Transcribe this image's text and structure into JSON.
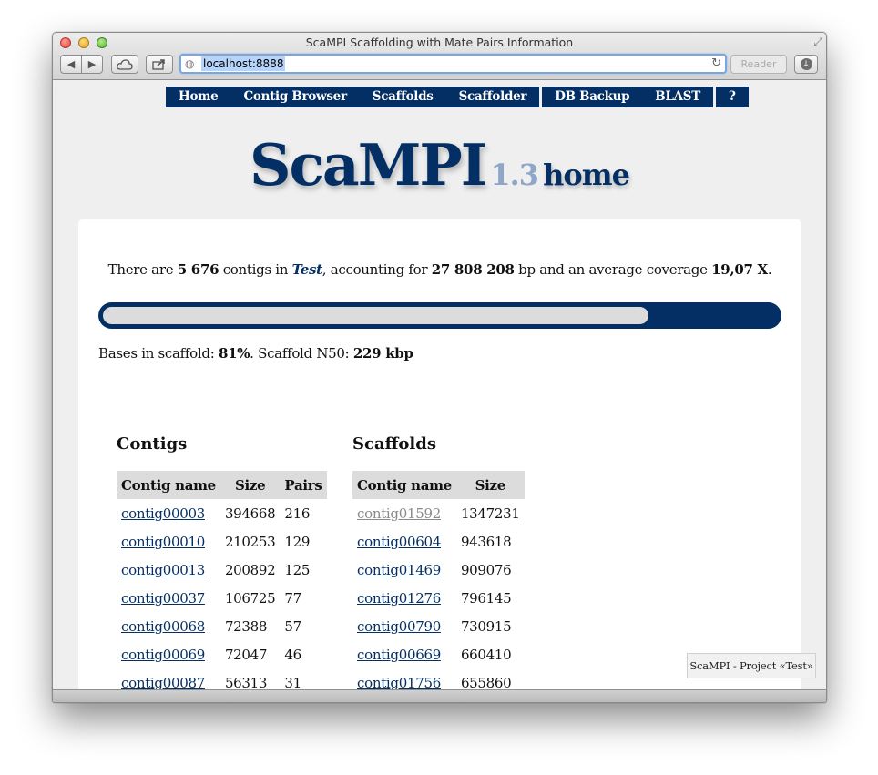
{
  "window": {
    "title": "ScaMPI Scaffolding with Mate Pairs Information",
    "url": "localhost:8888",
    "reader_label": "Reader"
  },
  "icons": {
    "back": "chevron-left-icon",
    "forward": "chevron-right-icon",
    "icloud": "cloud-icon",
    "share": "share-icon",
    "globe": "globe-icon",
    "reload": "reload-icon",
    "downloads": "download-icon",
    "fullscreen": "fullscreen-icon"
  },
  "nav": {
    "group1": [
      "Home",
      "Contig Browser",
      "Scaffolds",
      "Scaffolder"
    ],
    "group2": [
      "DB Backup",
      "BLAST"
    ],
    "group3": [
      "?"
    ]
  },
  "logo": {
    "name": "ScaMPI",
    "version": "1.3",
    "page": "home"
  },
  "summary": {
    "t1": "There are ",
    "contigs": "5 676",
    "t2": " contigs in ",
    "project": "Test",
    "t3": ", accounting for ",
    "bp": "27 808 208",
    "t4": " bp and an average coverage ",
    "coverage": "19,07 X",
    "t5": "."
  },
  "progress": {
    "fraction": 0.81
  },
  "bases": {
    "t1": "Bases in scaffold: ",
    "pct": "81%",
    "t2": ". Scaffold N50: ",
    "n50": "229 kbp"
  },
  "contigs": {
    "title": "Contigs",
    "headers": [
      "Contig name",
      "Size",
      "Pairs"
    ],
    "rows": [
      [
        "contig00003",
        "394668",
        "216"
      ],
      [
        "contig00010",
        "210253",
        "129"
      ],
      [
        "contig00013",
        "200892",
        "125"
      ],
      [
        "contig00037",
        "106725",
        "77"
      ],
      [
        "contig00068",
        "72388",
        "57"
      ],
      [
        "contig00069",
        "72047",
        "46"
      ],
      [
        "contig00087",
        "56313",
        "31"
      ]
    ]
  },
  "scaffolds": {
    "title": "Scaffolds",
    "headers": [
      "Contig name",
      "Size"
    ],
    "rows": [
      [
        "contig01592",
        "1347231"
      ],
      [
        "contig00604",
        "943618"
      ],
      [
        "contig01469",
        "909076"
      ],
      [
        "contig01276",
        "796145"
      ],
      [
        "contig00790",
        "730915"
      ],
      [
        "contig00669",
        "660410"
      ],
      [
        "contig01756",
        "655860"
      ]
    ]
  },
  "footer": "ScaMPI - Project «Test»",
  "colors": {
    "navy": "#032f64",
    "version": "#8ea6c7",
    "visited_link": "#8a8a8a"
  }
}
